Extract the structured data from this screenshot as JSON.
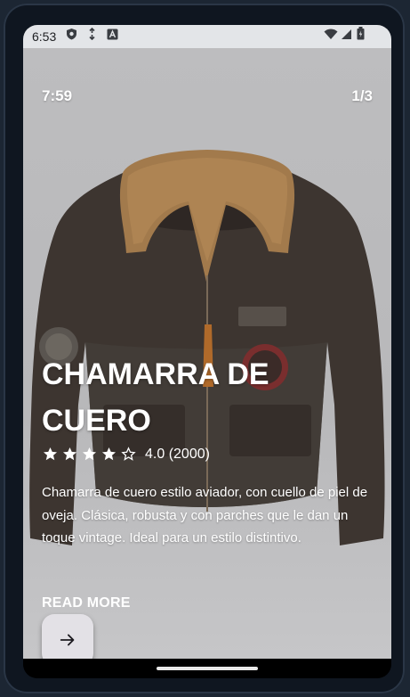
{
  "status_bar": {
    "time": "6:53",
    "icons": [
      "shield-icon",
      "sync-icon",
      "a-icon",
      "wifi-icon",
      "signal-icon",
      "battery-icon"
    ]
  },
  "story": {
    "time": "7:59",
    "page_indicator": "1/3"
  },
  "product": {
    "title": "CHAMARRA DE CUERO",
    "rating": 4.0,
    "rating_text": "4.0 (2000)",
    "stars_filled": 4,
    "stars_total": 5,
    "description": "Chamarra de cuero estilo aviador, con cuello de piel de oveja. Clásica, robusta y con parches que le dan un toque vintage. Ideal para un estilo distintivo.",
    "read_more": "READ MORE"
  },
  "fab": {
    "icon": "arrow-right-icon"
  },
  "colors": {
    "text": "#ffffff",
    "background": "#bdbdbf",
    "fab": "#e3e1e6"
  }
}
